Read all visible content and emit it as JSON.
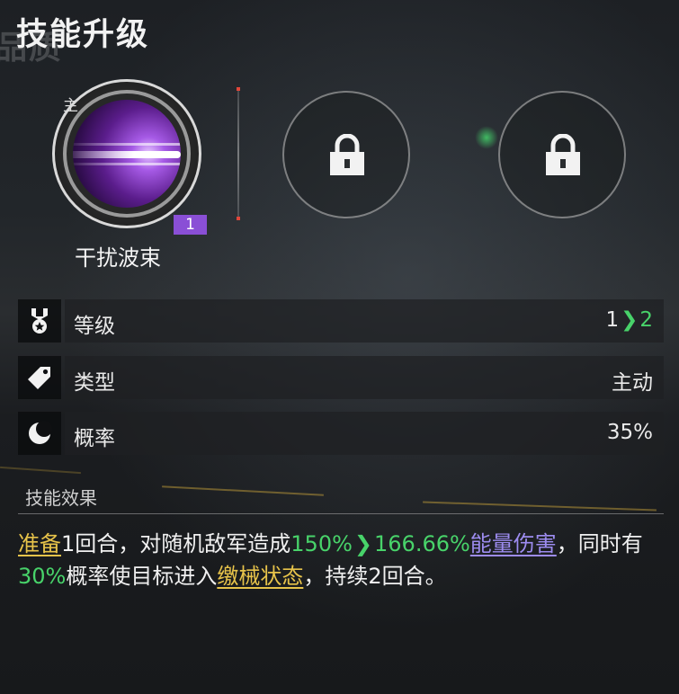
{
  "header": {
    "title": "技能升级",
    "background_text": "品质"
  },
  "skill_slots": {
    "active": {
      "name": "干扰波束",
      "tag": "主",
      "level_badge": "1",
      "icon": "purple-energy-beam-icon"
    },
    "locked": [
      {
        "icon": "lock-icon"
      },
      {
        "icon": "lock-icon"
      }
    ]
  },
  "stats": [
    {
      "icon": "medal-icon",
      "label": "等级",
      "value_from": "1",
      "value_to": "2"
    },
    {
      "icon": "tag-icon",
      "label": "类型",
      "value": "主动"
    },
    {
      "icon": "moon-icon",
      "label": "概率",
      "value": "35%"
    }
  ],
  "effect": {
    "section_title": "技能效果",
    "parts": {
      "p1": "准备",
      "p2": "1回合，对随机敌军造成",
      "p3": "150%",
      "p4": "166.66%",
      "p5": "能量伤害",
      "p6": "，同时有",
      "p7": "30%",
      "p8": "概率使目标进入",
      "p9": "缴械状态",
      "p10": "，持续2回合。"
    }
  },
  "colors": {
    "accent_green": "#48d36a",
    "keyword_yellow": "#e7c34a",
    "keyword_purple": "#9d8cf0",
    "level_badge": "#8a4fd6"
  }
}
